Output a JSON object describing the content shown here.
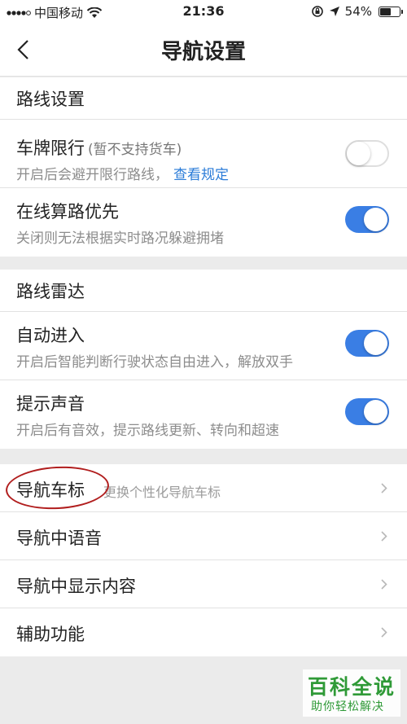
{
  "status_bar": {
    "carrier": "中国移动",
    "time": "21:36",
    "battery": "54%"
  },
  "header": {
    "title": "导航设置"
  },
  "route_settings": {
    "title": "路线设置",
    "items": [
      {
        "label": "车牌限行",
        "sub_label": "(暂不支持货车)",
        "desc": "开启后会避开限行路线，",
        "link": "查看规定",
        "enabled": false
      },
      {
        "label": "在线算路优先",
        "desc": "关闭则无法根据实时路况躲避拥堵",
        "enabled": true
      }
    ]
  },
  "route_radar": {
    "title": "路线雷达",
    "items": [
      {
        "label": "自动进入",
        "desc": "开启后智能判断行驶状态自由进入，解放双手",
        "enabled": true
      },
      {
        "label": "提示声音",
        "desc": "开启后有音效，提示路线更新、转向和超速",
        "enabled": true
      }
    ]
  },
  "nav_links": {
    "items": [
      {
        "label": "导航车标",
        "desc": "更换个性化导航车标"
      },
      {
        "label": "导航中语音"
      },
      {
        "label": "导航中显示内容"
      },
      {
        "label": "辅助功能"
      }
    ]
  },
  "watermark": {
    "main": "百科全说",
    "sub": "助你轻松解决"
  },
  "colors": {
    "accent": "#3a7ee4",
    "link": "#2b7cd8",
    "annotation": "#b11e1e",
    "watermark": "#2f9a37"
  }
}
